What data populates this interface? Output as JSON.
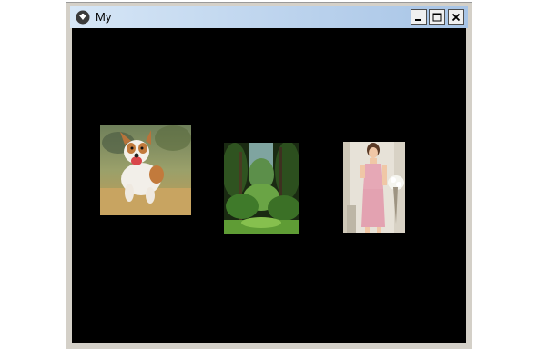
{
  "window": {
    "title": "My",
    "controls": [
      "minimize-icon",
      "maximize-icon",
      "close-icon"
    ]
  },
  "images": [
    {
      "subject": "dog"
    },
    {
      "subject": "forest"
    },
    {
      "subject": "woman"
    }
  ]
}
